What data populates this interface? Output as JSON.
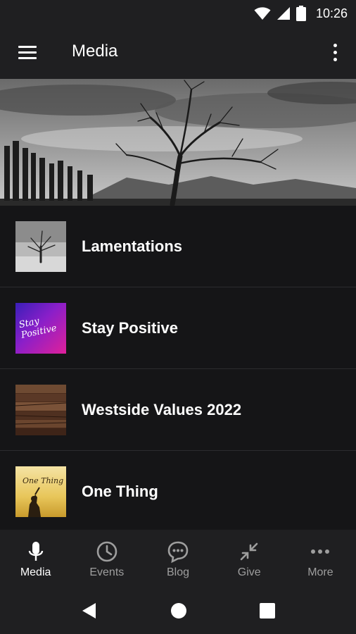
{
  "status_bar": {
    "time": "10:26",
    "icons": [
      "wifi-icon",
      "cell-signal-icon",
      "battery-icon"
    ]
  },
  "app_bar": {
    "title": "Media",
    "menu_icon": "hamburger-menu-icon",
    "overflow_icon": "more-vert-icon"
  },
  "media_list": [
    {
      "title": "Lamentations",
      "thumbnail": "lone-tree-lake-bw"
    },
    {
      "title": "Stay Positive",
      "thumbnail": "stay-positive-gradient"
    },
    {
      "title": "Westside Values 2022",
      "thumbnail": "wood-planks"
    },
    {
      "title": "One Thing",
      "thumbnail": "one-thing-sunset"
    }
  ],
  "thumb_text": {
    "stay_positive": "Stay Positive",
    "one_thing": "One Thing"
  },
  "bottom_nav": [
    {
      "label": "Media",
      "icon": "microphone-icon",
      "active": true
    },
    {
      "label": "Events",
      "icon": "clock-icon",
      "active": false
    },
    {
      "label": "Blog",
      "icon": "chat-bubble-icon",
      "active": false
    },
    {
      "label": "Give",
      "icon": "compress-arrows-icon",
      "active": false
    },
    {
      "label": "More",
      "icon": "more-horiz-icon",
      "active": false
    }
  ],
  "colors": {
    "background": "#151517",
    "bars": "#1f1f21",
    "active": "#ffffff",
    "inactive": "#9e9e9e"
  }
}
